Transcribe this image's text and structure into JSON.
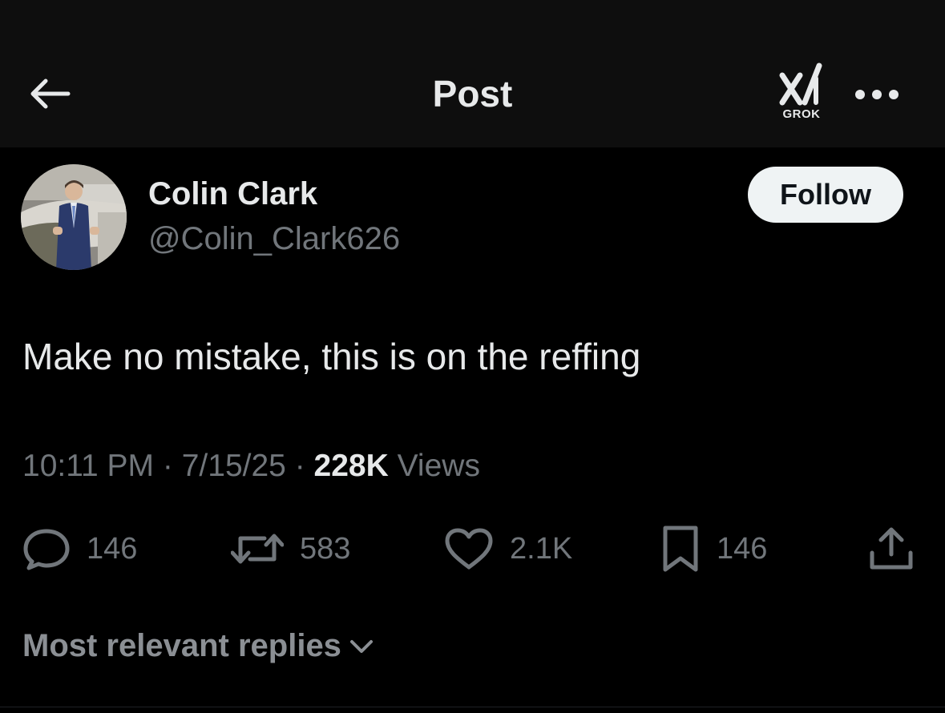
{
  "header": {
    "title": "Post",
    "back_icon": "arrow-left-icon",
    "grok_label": "GROK",
    "more_icon": "more-horizontal-icon"
  },
  "author": {
    "display_name": "Colin Clark",
    "handle": "@Colin_Clark626",
    "follow_label": "Follow"
  },
  "post": {
    "text": "Make no mistake, this is on the reffing",
    "time": "10:11 PM",
    "date": "7/15/25",
    "separator": "·",
    "views_count": "228K",
    "views_label": "Views"
  },
  "actions": {
    "replies": "146",
    "reposts": "583",
    "likes": "2.1K",
    "bookmarks": "146"
  },
  "replies_sort": {
    "label": "Most relevant replies",
    "icon": "chevron-down-icon"
  },
  "colors": {
    "background": "#000000",
    "header_background": "#0e0e0e",
    "primary_text": "#e7e9ea",
    "secondary_text": "#71767b",
    "follow_button": "#eff3f4"
  }
}
